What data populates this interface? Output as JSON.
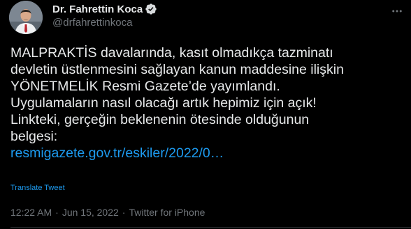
{
  "author": {
    "display_name": "Dr. Fahrettin Koca",
    "handle": "@drfahrettinkoca",
    "verified": true
  },
  "tweet": {
    "lines": [
      "MALPRAKTİS davalarında, kasıt olmadıkça tazminatı",
      "devletin üstlenmesini sağlayan kanun maddesine ilişkin",
      "YÖNETMELİK Resmi Gazete’de yayımlandı.",
      "Uygulamaların nasıl olacağı artık hepimiz için açık!",
      "Linkteki, gerçeğin beklenenin ötesinde olduğunun",
      "belgesi:"
    ],
    "link_text": "resmigazete.gov.tr/eskiler/2022/0…",
    "translate_label": "Translate Tweet"
  },
  "meta": {
    "time": "12:22 AM",
    "separator": "·",
    "date": "Jun 15, 2022",
    "source": "Twitter for iPhone"
  },
  "icons": {
    "verified": "verified-badge-icon",
    "more": "more-options-icon"
  },
  "colors": {
    "background": "#000000",
    "text": "#e7e9ea",
    "secondary": "#71767b",
    "link": "#1d9bf0",
    "verified_badge": "#d6d9db"
  }
}
